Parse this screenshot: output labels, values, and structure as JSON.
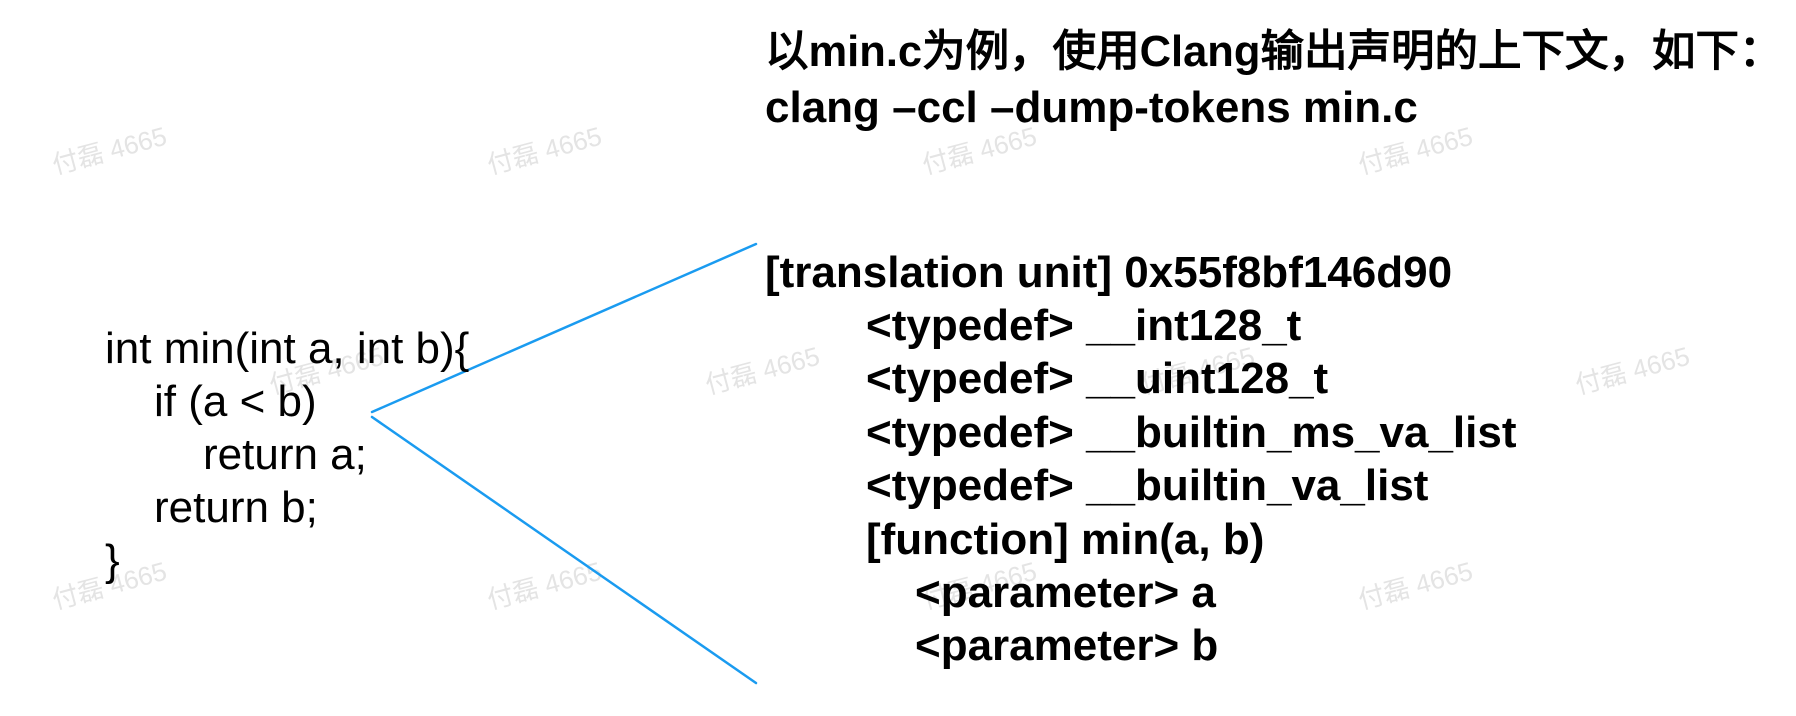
{
  "title": {
    "line1": "以min.c为例，使用Clang输出声明的上下文，如下：",
    "line2": "clang –ccl –dump-tokens min.c"
  },
  "code": {
    "lines": [
      "int min(int a, int b){",
      "if (a < b)",
      "return a;",
      "return b;",
      "}"
    ]
  },
  "ast": {
    "lines": [
      "[translation unit] 0x55f8bf146d90",
      "<typedef> __int128_t",
      "<typedef> __uint128_t",
      "<typedef> __builtin_ms_va_list",
      "<typedef> __builtin_va_list",
      "[function] min(a, b)",
      "<parameter> a",
      "<parameter> b"
    ]
  },
  "watermark": "付磊 4665",
  "colors": {
    "connector": "#1a9bf0",
    "text": "#000000",
    "watermark": "#e4e4e4",
    "background": "#ffffff"
  }
}
